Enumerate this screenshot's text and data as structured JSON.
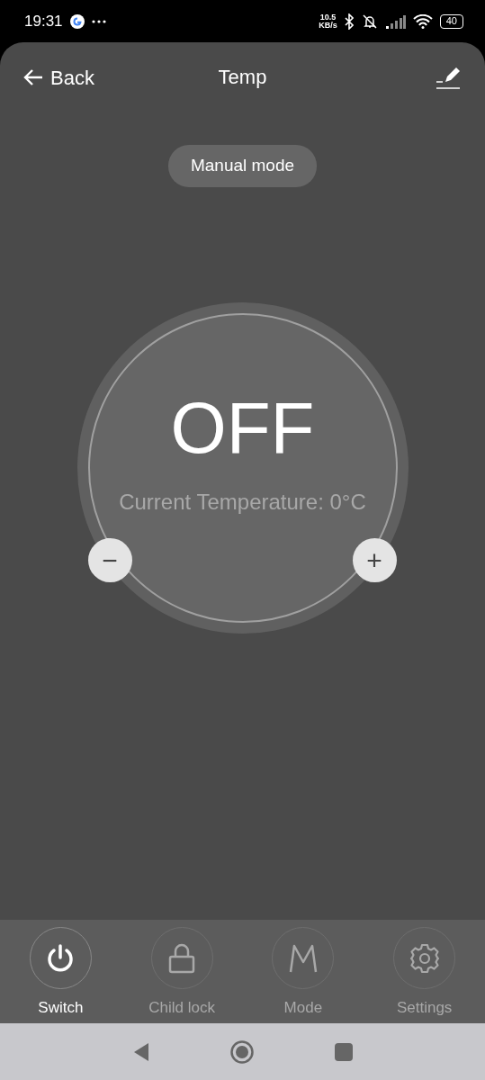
{
  "status_bar": {
    "time": "19:31",
    "net_speed": "10.5",
    "net_unit": "KB/s",
    "battery": "40"
  },
  "header": {
    "back": "Back",
    "title": "Temp"
  },
  "mode_badge": "Manual mode",
  "dial": {
    "state": "OFF",
    "reading": "Current Temperature: 0°C",
    "minus": "−",
    "plus": "+"
  },
  "actions": [
    {
      "kind": "power",
      "label": "Switch",
      "selected": true
    },
    {
      "kind": "lock",
      "label": "Child lock",
      "selected": false
    },
    {
      "kind": "mode",
      "label": "Mode",
      "selected": false
    },
    {
      "kind": "gear",
      "label": "Settings",
      "selected": false
    }
  ]
}
